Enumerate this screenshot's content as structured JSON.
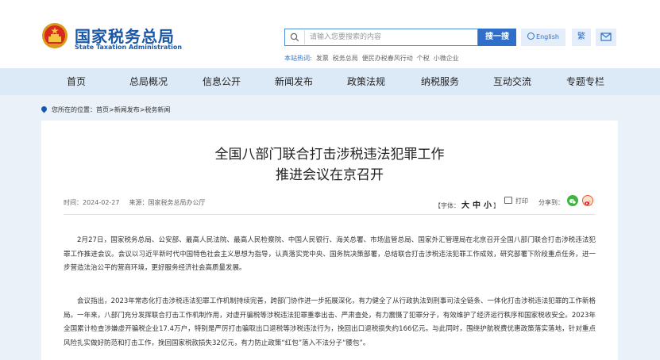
{
  "header": {
    "logo_cn": "国家税务总局",
    "logo_en": "State Taxation Administration",
    "search_placeholder": "请输入您要搜索的内容",
    "search_button": "搜一搜",
    "english_button": "English",
    "traditional_button": "繁",
    "hot_label": "本站热词:",
    "hot_words": [
      "发票",
      "税务总局",
      "便民办税春风行动",
      "个税",
      "小微企业"
    ]
  },
  "nav": {
    "items": [
      "首页",
      "总局概况",
      "信息公开",
      "新闻发布",
      "政策法规",
      "纳税服务",
      "互动交流",
      "专题专栏"
    ]
  },
  "breadcrumb": {
    "label": "您所在的位置：",
    "path": "首页>新闻发布>税务新闻"
  },
  "article": {
    "title_line1": "全国八部门联合打击涉税违法犯罪工作",
    "title_line2": "推进会议在京召开",
    "date": "时间：2024-02-27",
    "source": "来源：国家税务总局办公厅",
    "font_label": "【字体：",
    "font_large": "大",
    "font_medium": "中",
    "font_small": "小",
    "font_close": "】",
    "print_label": "打印",
    "share_label": "分享到：",
    "paragraph1": "2月27日，国家税务总局、公安部、最高人民法院、最高人民检察院、中国人民银行、海关总署、市场监管总局、国家外汇管理局在北京召开全国八部门联合打击涉税违法犯罪工作推进会议。会议以习近平新时代中国特色社会主义思想为指导，认真落实党中央、国务院决策部署，总结联合打击涉税违法犯罪工作成效，研究部署下阶段重点任务，进一步营造法治公平的营商环境，更好服务经济社会高质量发展。",
    "paragraph2": "会议指出，2023年常态化打击涉税违法犯罪工作机制持续完善，跨部门协作进一步拓展深化，有力健全了从行政执法到刑事司法全链条、一体化打击涉税违法犯罪的工作新格局。一年来，八部门充分发挥联合打击工作机制作用，对虚开骗税等涉税违法犯罪重拳出击、严肃查处，有力震慑了犯罪分子，有效维护了经济运行秩序和国家税收安全。2023年全国累计检查涉嫌虚开骗税企业17.4万户，特别是严厉打击骗取出口退税等涉税违法行为，挽回出口退税损失约166亿元。与此同时，围绕护航税费优惠政策落实落地，针对重点风险扎实做好防范和打击工作，挽回国家税款损失32亿元，有力防止政策“红包”落入不法分子“腰包”。"
  },
  "colors": {
    "brand_blue": "#1b57a7",
    "button_blue": "#2f6fc9",
    "nav_bg": "#dce9f7",
    "page_bg": "#eaf1f8"
  }
}
